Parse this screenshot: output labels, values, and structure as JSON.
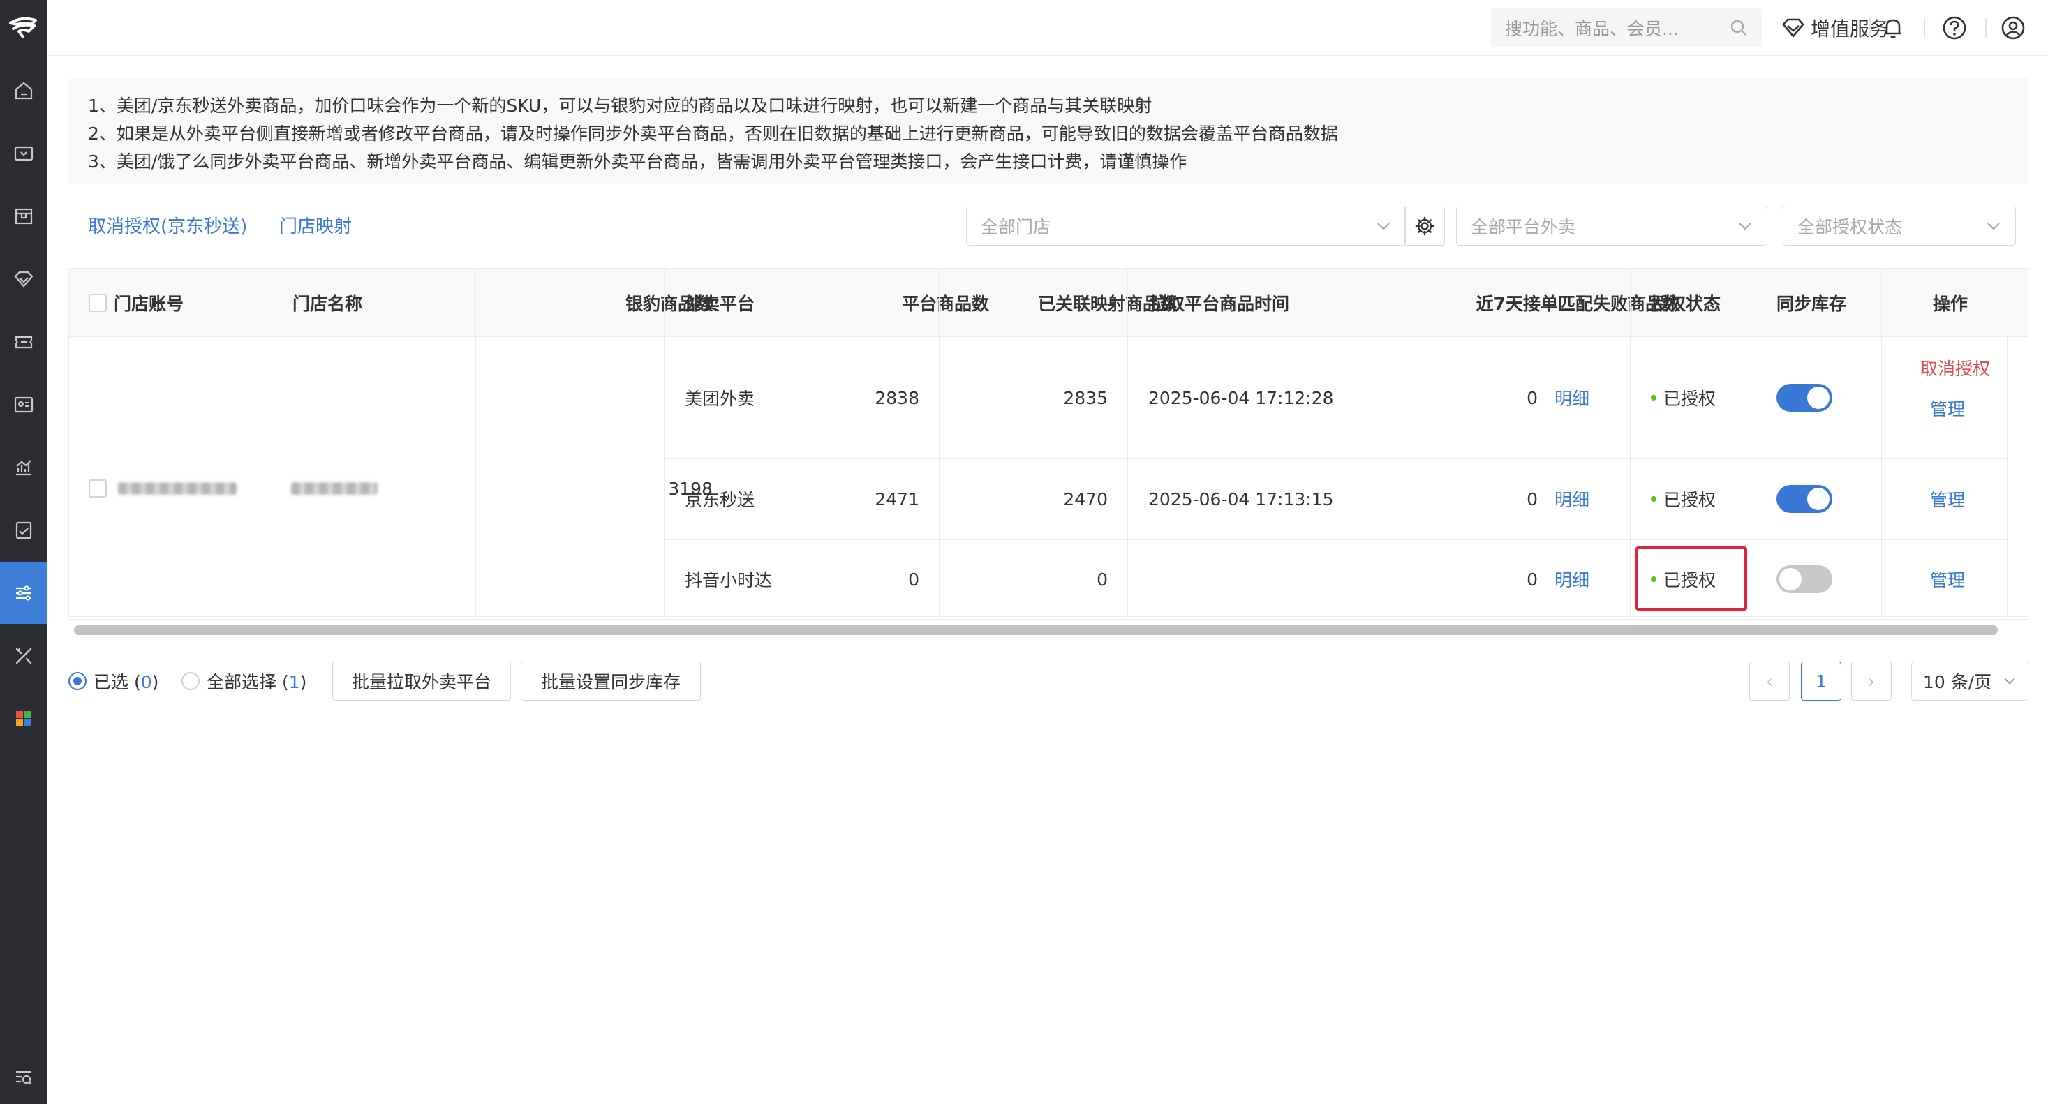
{
  "header": {
    "search_placeholder": "搜功能、商品、会员...",
    "value_added": "增值服务"
  },
  "notice": {
    "lines": [
      "1、美团/京东秒送外卖商品，加价口味会作为一个新的SKU，可以与银豹对应的商品以及口味进行映射，也可以新建一个商品与其关联映射",
      "2、如果是从外卖平台侧直接新增或者修改平台商品，请及时操作同步外卖平台商品，否则在旧数据的基础上进行更新商品，可能导致旧的数据会覆盖平台商品数据",
      "3、美团/饿了么同步外卖平台商品、新增外卖平台商品、编辑更新外卖平台商品，皆需调用外卖平台管理类接口，会产生接口计费，请谨慎操作"
    ]
  },
  "toolbar": {
    "cancel_auth": "取消授权(京东秒送)",
    "store_mapping": "门店映射",
    "store_select": "全部门店",
    "platform_select": "全部平台外卖",
    "auth_select": "全部授权状态"
  },
  "table": {
    "headers": [
      "门店账号",
      "门店名称",
      "银豹商品数",
      "外卖平台",
      "平台商品数",
      "已关联映射商品数",
      "拉取平台商品时间",
      "近7天接单匹配失败商品数",
      "授权状态",
      "同步库存",
      "操作"
    ],
    "store_goods_count": "3198",
    "rows": [
      {
        "platform": "美团外卖",
        "platform_goods": "2838",
        "mapped": "2835",
        "pull_time": "2025-06-04 17:12:28",
        "fail": "0",
        "detail": "明细",
        "status": "已授权",
        "sync": true,
        "action_cancel": "取消授权",
        "action_manage": "管理"
      },
      {
        "platform": "京东秒送",
        "platform_goods": "2471",
        "mapped": "2470",
        "pull_time": "2025-06-04 17:13:15",
        "fail": "0",
        "detail": "明细",
        "status": "已授权",
        "sync": true,
        "action_manage": "管理"
      },
      {
        "platform": "抖音小时达",
        "platform_goods": "0",
        "mapped": "0",
        "pull_time": "",
        "fail": "0",
        "detail": "明细",
        "status": "已授权",
        "sync": false,
        "action_manage": "管理"
      }
    ]
  },
  "footer": {
    "selected_label": "已选 (",
    "selected_count": "0",
    "close_paren": ")",
    "select_all_label": "全部选择 (",
    "select_all_count": "1",
    "batch_pull": "批量拉取外卖平台",
    "batch_sync": "批量设置同步库存",
    "prev": "‹",
    "page": "1",
    "next": "›",
    "page_size": "10 条/页"
  },
  "colors": {
    "sidebar_bg": "#2b2d33",
    "accent": "#3a78d8",
    "danger": "#e54545",
    "highlight": "#e2233a",
    "success": "#52c41a"
  }
}
